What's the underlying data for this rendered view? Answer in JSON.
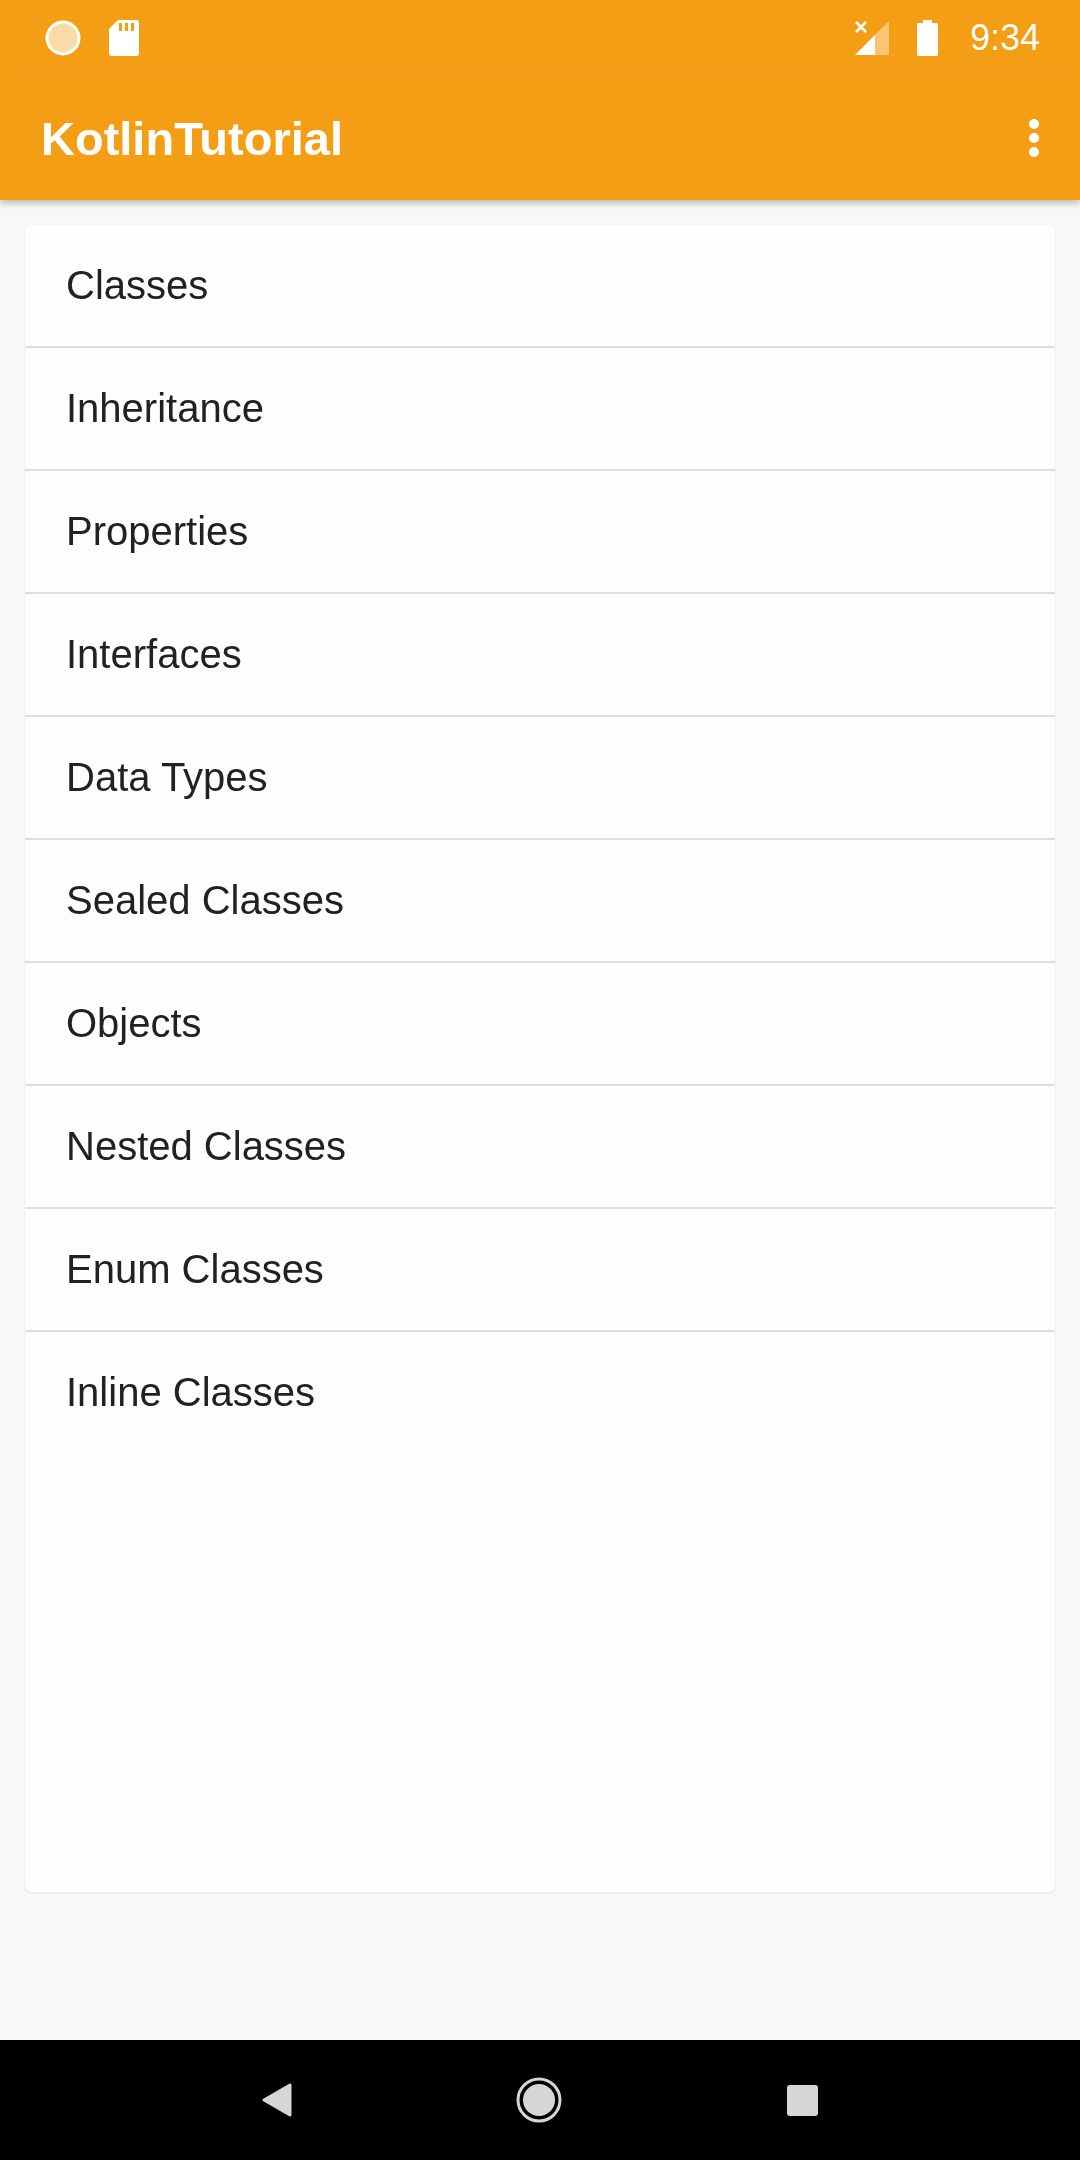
{
  "status_bar": {
    "time": "9:34"
  },
  "app_bar": {
    "title": "KotlinTutorial"
  },
  "topics": [
    "Classes",
    "Inheritance",
    "Properties",
    "Interfaces",
    "Data Types",
    "Sealed Classes",
    "Objects",
    "Nested Classes",
    "Enum Classes",
    "Inline Classes"
  ]
}
